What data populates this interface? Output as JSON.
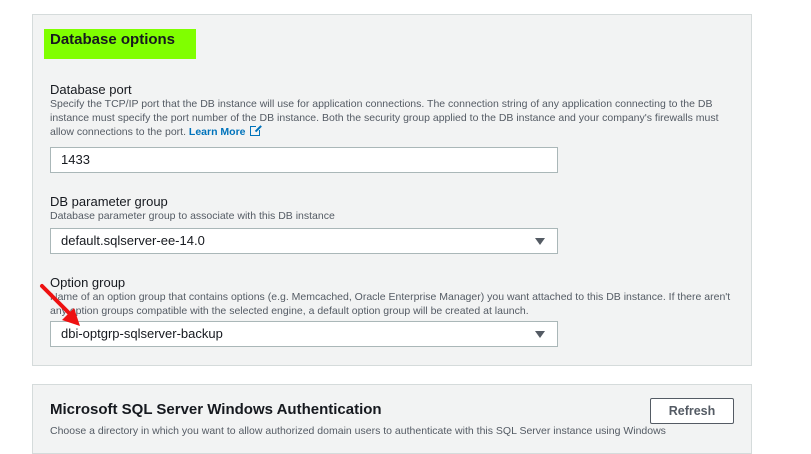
{
  "database_options": {
    "title": "Database options",
    "highlight_color": "#80ff00",
    "port": {
      "label": "Database port",
      "description": "Specify the TCP/IP port that the DB instance will use for application connections. The connection string of any application connecting to the DB instance must specify the port number of the DB instance. Both the security group applied to the DB instance and your company's firewalls must allow connections to the port.",
      "learn_more": "Learn More",
      "learn_more_icon": "external-link-icon",
      "value": "1433"
    },
    "parameter_group": {
      "label": "DB parameter group",
      "description": "Database parameter group to associate with this DB instance",
      "value": "default.sqlserver-ee-14.0"
    },
    "option_group": {
      "label": "Option group",
      "description": "Name of an option group that contains options (e.g. Memcached, Oracle Enterprise Manager) you want attached to this DB instance. If there aren't any option groups compatible with the selected engine, a default option group will be created at launch.",
      "value": "dbi-optgrp-sqlserver-backup",
      "annotation_arrow_color": "#ee1111"
    }
  },
  "windows_auth": {
    "title": "Microsoft SQL Server Windows Authentication",
    "refresh_label": "Refresh",
    "description": "Choose a directory in which you want to allow authorized domain users to authenticate with this SQL Server instance using Windows"
  }
}
